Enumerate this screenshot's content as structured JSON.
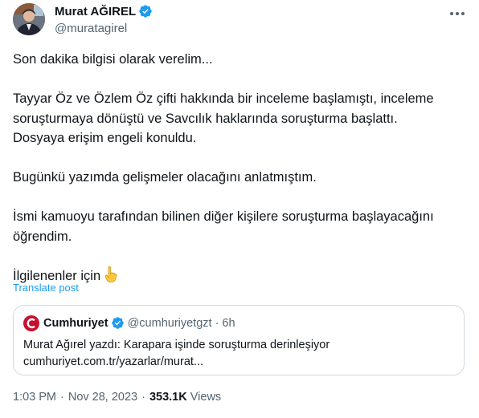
{
  "author": {
    "name": "Murat AĞIREL",
    "handle": "@muratagirel"
  },
  "post": {
    "paragraphs": [
      [
        "Son dakika bilgisi olarak verelim..."
      ],
      [
        "Tayyar Öz ve Özlem Öz çifti hakkında bir inceleme başlamıştı, inceleme",
        "soruşturmaya dönüştü ve Savcılık haklarında soruşturma başlattı.",
        "Dosyaya erişim engeli konuldu."
      ],
      [
        "Bugünkü yazımda gelişmeler olacağını anlatmıştım."
      ],
      [
        "İsmi kamuoyu tarafından bilinen diğer kişilere soruşturma başlayacağını",
        "öğrendim."
      ],
      [
        "İlgilenenler için"
      ]
    ],
    "final_emoji": "pointing-down-emoji",
    "translate_label": "Translate post"
  },
  "quote": {
    "name": "Cumhuriyet",
    "handle": "@cumhuriyetgzt",
    "dot": "·",
    "time": "6h",
    "line1": "Murat Ağırel yazdı: Karapara işinde soruşturma derinleşiyor",
    "line2": "cumhuriyet.com.tr/yazarlar/murat...",
    "logo_icon": "cumhuriyet-logo-icon"
  },
  "meta": {
    "time": "1:03 PM",
    "date": "Nov 28, 2023",
    "sep": "·",
    "views_count": "353.1K",
    "views_label": "Views"
  },
  "colors": {
    "verified": "#1d9bf0",
    "link": "#1d9bf0",
    "muted": "#536471",
    "border": "#cfd9de",
    "cumhuriyet_red": "#c8102e"
  }
}
